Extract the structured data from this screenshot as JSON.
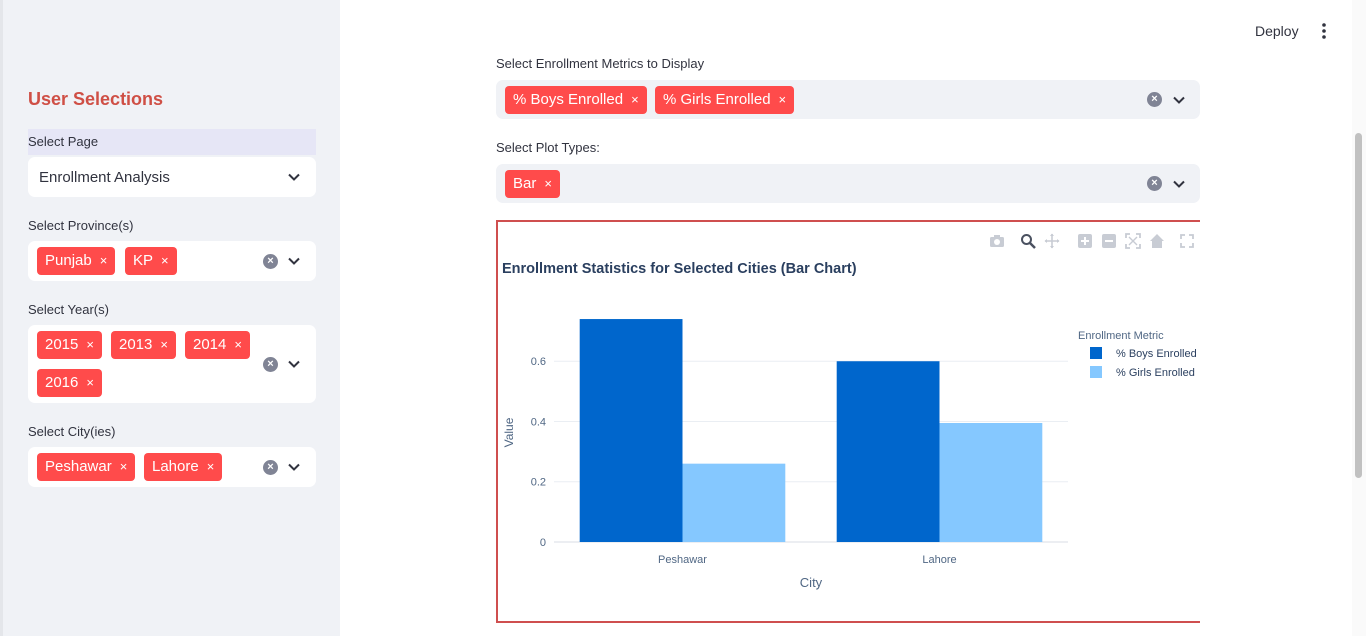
{
  "sidebar": {
    "title": "User Selections",
    "page": {
      "label": "Select Page",
      "value": "Enrollment Analysis"
    },
    "provinces": {
      "label": "Select Province(s)",
      "tags": [
        "Punjab",
        "KP"
      ]
    },
    "years": {
      "label": "Select Year(s)",
      "tags": [
        "2015",
        "2013",
        "2014",
        "2016"
      ]
    },
    "cities": {
      "label": "Select City(ies)",
      "tags": [
        "Peshawar",
        "Lahore"
      ]
    },
    "tag_close": "×"
  },
  "header": {
    "deploy_label": "Deploy"
  },
  "main": {
    "metrics": {
      "label": "Select Enrollment Metrics to Display",
      "tags": [
        "% Boys Enrolled",
        "% Girls Enrolled"
      ]
    },
    "plot_types": {
      "label": "Select Plot Types:",
      "tags": [
        "Bar"
      ]
    }
  },
  "colors": {
    "accent": "#ff4b4b",
    "boys": "#0066cc",
    "girls": "#85c8ff",
    "frame": "#cf4f4f"
  },
  "chart_data": {
    "type": "bar",
    "title": "Enrollment Statistics for Selected Cities (Bar Chart)",
    "xlabel": "City",
    "ylabel": "Value",
    "categories": [
      "Peshawar",
      "Lahore"
    ],
    "series": [
      {
        "name": "% Boys Enrolled",
        "values": [
          0.74,
          0.6
        ]
      },
      {
        "name": "% Girls Enrolled",
        "values": [
          0.26,
          0.395
        ]
      }
    ],
    "yticks": [
      "0",
      "0.2",
      "0.4",
      "0.6"
    ],
    "ylim": [
      0,
      0.78
    ],
    "legend_title": "Enrollment Metric",
    "legend_position": "right",
    "grid": true
  }
}
